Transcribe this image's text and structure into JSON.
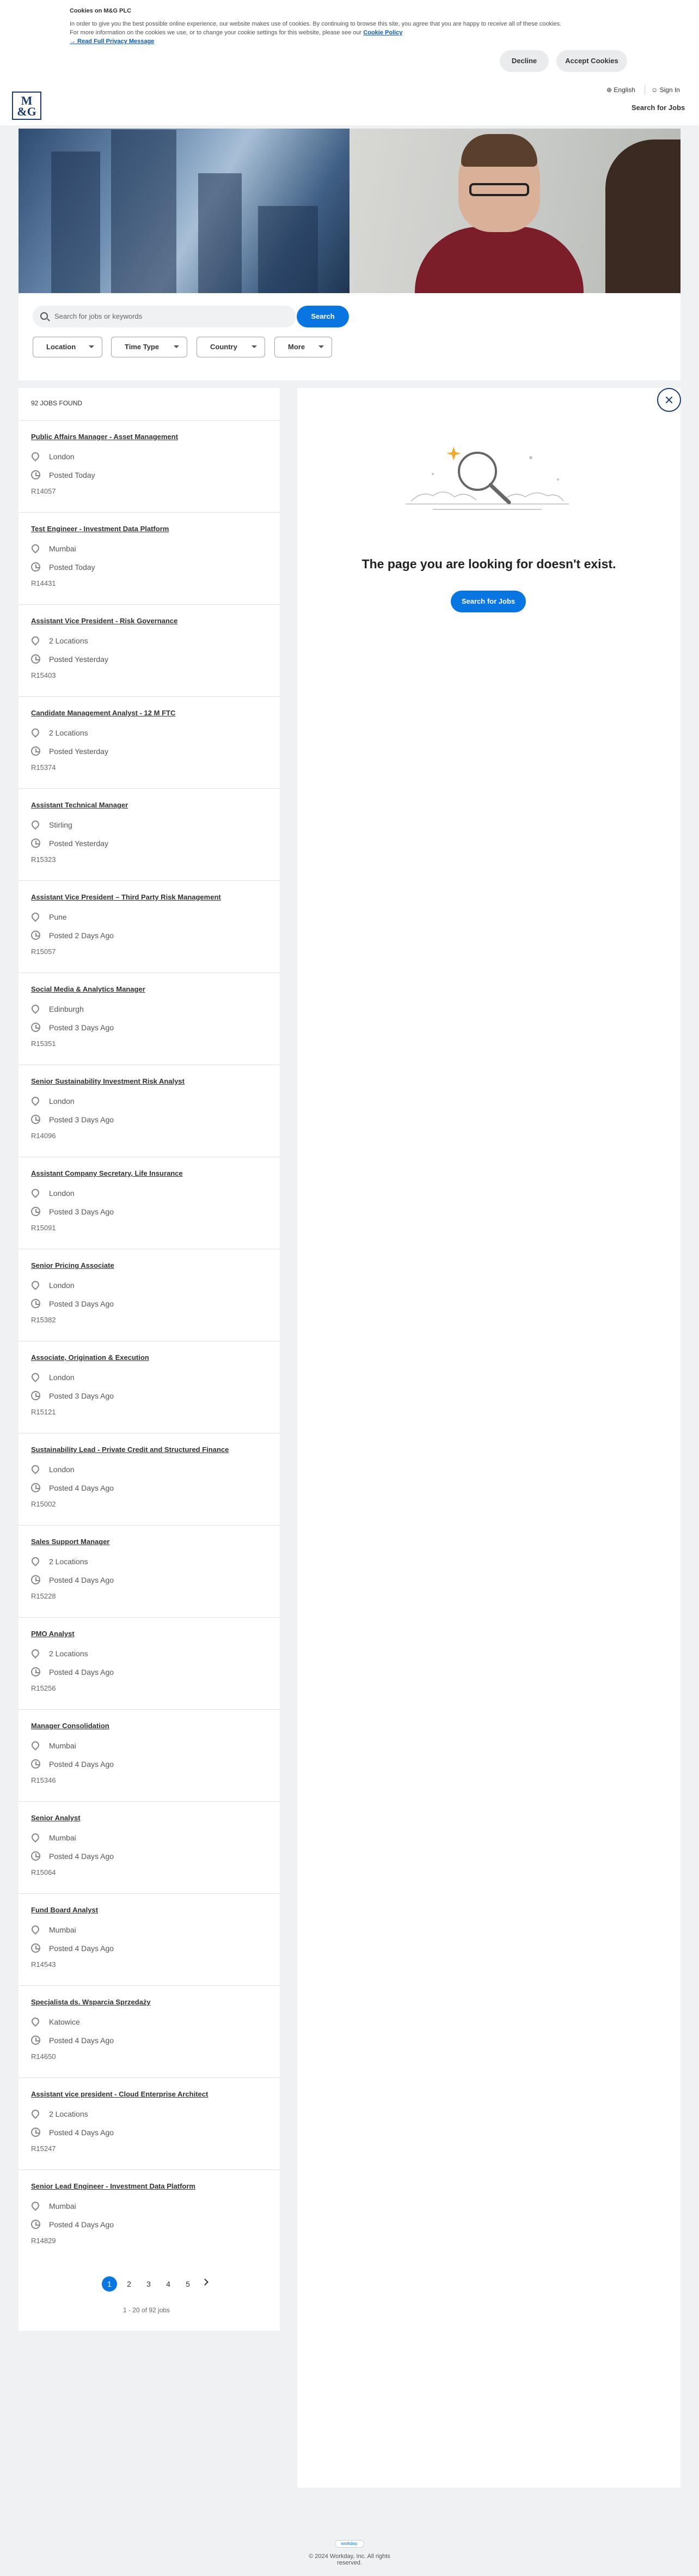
{
  "cookie": {
    "title": "Cookies on M&G PLC",
    "line1": "In order to give you the best possible online experience, our website makes use of cookies. By continuing to browse this site, you agree that you are happy to receive all of these cookies.",
    "line2_prefix": "For more information on the cookies we use, or to change your cookie settings for this website, please see our ",
    "policy_link": "Cookie Policy",
    "privacy_link": "→ Read Full Privacy Message",
    "decline_label": "Decline",
    "accept_label": "Accept Cookies"
  },
  "header": {
    "logo_line1": "M",
    "logo_line2": "&G",
    "language": "English",
    "sign_in": "Sign In",
    "search_for_jobs": "Search for Jobs"
  },
  "search": {
    "placeholder": "Search for jobs or keywords",
    "button": "Search",
    "filters": [
      "Location",
      "Time Type",
      "Country",
      "More"
    ]
  },
  "results": {
    "count_label": "92 JOBS FOUND",
    "jobs": [
      {
        "title": "Public Affairs Manager - Asset Management",
        "location": "London",
        "posted": "Posted Today",
        "ref": "R14057"
      },
      {
        "title": "Test Engineer - Investment Data Platform",
        "location": "Mumbai",
        "posted": "Posted Today",
        "ref": "R14431"
      },
      {
        "title": "Assistant Vice President - Risk Governance",
        "location": "2 Locations",
        "posted": "Posted Yesterday",
        "ref": "R15403"
      },
      {
        "title": "Candidate Management Analyst - 12 M FTC",
        "location": "2 Locations",
        "posted": "Posted Yesterday",
        "ref": "R15374"
      },
      {
        "title": "Assistant Technical Manager",
        "location": "Stirling",
        "posted": "Posted Yesterday",
        "ref": "R15323"
      },
      {
        "title": "Assistant Vice President – Third Party Risk Management",
        "location": "Pune",
        "posted": "Posted 2 Days Ago",
        "ref": "R15057"
      },
      {
        "title": "Social Media & Analytics Manager",
        "location": "Edinburgh",
        "posted": "Posted 3 Days Ago",
        "ref": "R15351"
      },
      {
        "title": "Senior Sustainability Investment Risk Analyst",
        "location": "London",
        "posted": "Posted 3 Days Ago",
        "ref": "R14096"
      },
      {
        "title": "Assistant Company Secretary, Life Insurance",
        "location": "London",
        "posted": "Posted 3 Days Ago",
        "ref": "R15091"
      },
      {
        "title": "Senior Pricing Associate",
        "location": "London",
        "posted": "Posted 3 Days Ago",
        "ref": "R15382"
      },
      {
        "title": "Associate, Origination & Execution",
        "location": "London",
        "posted": "Posted 3 Days Ago",
        "ref": "R15121"
      },
      {
        "title": "Sustainability Lead - Private Credit and Structured Finance",
        "location": "London",
        "posted": "Posted 4 Days Ago",
        "ref": "R15002"
      },
      {
        "title": "Sales Support Manager",
        "location": "2 Locations",
        "posted": "Posted 4 Days Ago",
        "ref": "R15228"
      },
      {
        "title": "PMO Analyst",
        "location": "2 Locations",
        "posted": "Posted 4 Days Ago",
        "ref": "R15256"
      },
      {
        "title": "Manager Consolidation",
        "location": "Mumbai",
        "posted": "Posted 4 Days Ago",
        "ref": "R15346"
      },
      {
        "title": "Senior Analyst",
        "location": "Mumbai",
        "posted": "Posted 4 Days Ago",
        "ref": "R15064"
      },
      {
        "title": "Fund Board Analyst",
        "location": "Mumbai",
        "posted": "Posted 4 Days Ago",
        "ref": "R14543"
      },
      {
        "title": "Specjalista ds. Wsparcia Sprzedaży",
        "location": "Katowice",
        "posted": "Posted 4 Days Ago",
        "ref": "R14650"
      },
      {
        "title": "Assistant vice president - Cloud Enterprise Architect",
        "location": "2 Locations",
        "posted": "Posted 4 Days Ago",
        "ref": "R15247"
      },
      {
        "title": "Senior Lead Engineer - Investment Data Platform",
        "location": "Mumbai",
        "posted": "Posted 4 Days Ago",
        "ref": "R14829"
      }
    ]
  },
  "pagination": {
    "pages": [
      "1",
      "2",
      "3",
      "4",
      "5"
    ],
    "current": "1",
    "summary": "1 - 20 of 92 jobs"
  },
  "detail": {
    "message": "The page you are looking for doesn't exist.",
    "button": "Search for Jobs"
  },
  "footer": {
    "logo_text": "workday.",
    "copyright": "© 2024 Workday, Inc. All rights reserved."
  },
  "colors": {
    "primary_blue": "#0875e1",
    "brand_navy": "#1b3a6a",
    "page_bg": "#eff1f3"
  }
}
